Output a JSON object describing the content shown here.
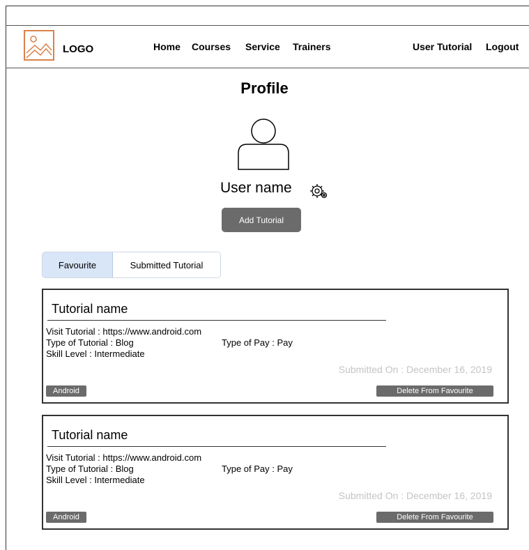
{
  "header": {
    "logo_text": "LOGO",
    "nav": [
      "Home",
      "Courses",
      "Service",
      "Trainers"
    ],
    "user_tutorial": "User Tutorial",
    "logout": "Logout"
  },
  "profile": {
    "title": "Profile",
    "user_name": "User name",
    "add_tutorial": "Add Tutorial"
  },
  "tabs": [
    "Favourite",
    "Submitted Tutorial"
  ],
  "active_tab": "Favourite",
  "cards": [
    {
      "name": "Tutorial name",
      "visit": "Visit Tutorial : https://www.android.com",
      "type": "Type of Tutorial : Blog",
      "pay": "Type of Pay : Pay",
      "skill": "Skill Level : Intermediate",
      "submitted": "Submitted On : December 16, 2019",
      "tag": "Android",
      "delete": "Delete From Favourite"
    },
    {
      "name": "Tutorial name",
      "visit": "Visit Tutorial : https://www.android.com",
      "type": "Type of Tutorial : Blog",
      "pay": "Type of Pay : Pay",
      "skill": "Skill Level : Intermediate",
      "submitted": "Submitted On : December 16, 2019",
      "tag": "Android",
      "delete": "Delete From Favourite"
    }
  ],
  "colors": {
    "logo_accent": "#d9824a",
    "button_gray": "#6b6b6b",
    "tab_active_bg": "#d9e6f7",
    "muted_text": "#c4c4c4"
  }
}
